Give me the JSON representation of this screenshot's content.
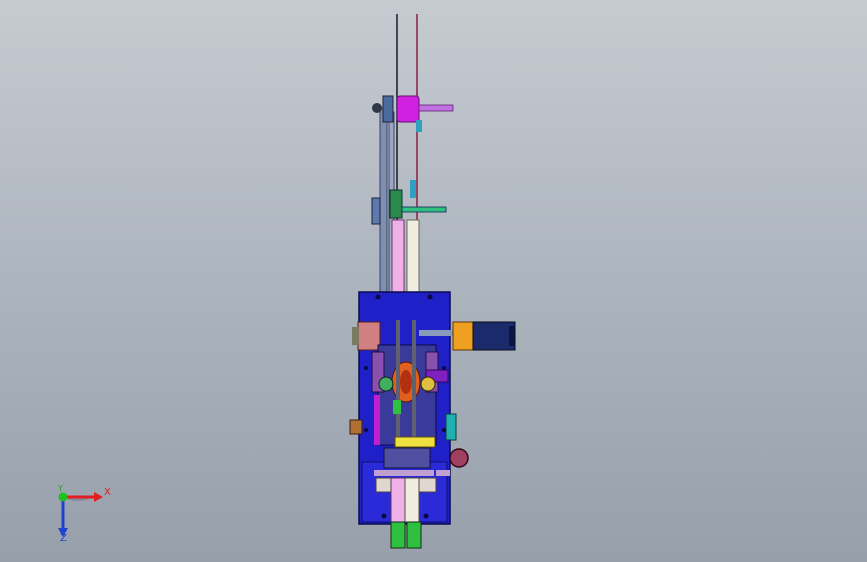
{
  "viewport": {
    "background_top": "#c6cbd1",
    "background_bottom": "#979fab",
    "content": "cad-assembly-model"
  },
  "triad": {
    "x_label": "X",
    "y_label": "Y",
    "z_label": "Z",
    "x_color": "#e02020",
    "y_color": "#20c020",
    "z_color": "#2040d0"
  },
  "colors": {
    "base_plate": "#2020c8",
    "rail": "#7f8fb3",
    "magenta": "#d020e0",
    "motor_orange": "#f0a020",
    "motor_navy": "#1a2a6a",
    "pink_strip": "#f0b0e8",
    "cream_strip": "#f0ece0",
    "green_foot": "#30c040",
    "salmon_block": "#d08080",
    "yellow_bar": "#f0e040",
    "purple": "#8020c0",
    "teal": "#20b0b0"
  }
}
